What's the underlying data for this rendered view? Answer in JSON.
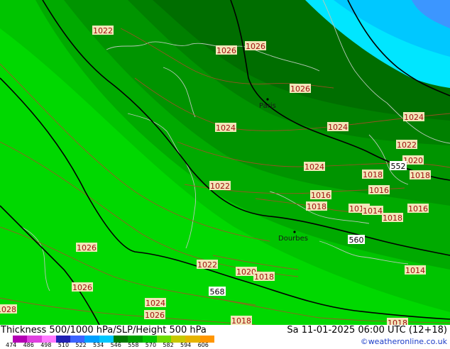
{
  "map": {
    "pressure_labels": [
      "1022",
      "1026",
      "1026",
      "1026",
      "1024",
      "1024",
      "1024",
      "1022",
      "1020",
      "1018",
      "1024",
      "1022",
      "1018",
      "1016",
      "1016",
      "1018",
      "1016",
      "1016",
      "1014",
      "1018",
      "1026",
      "1022",
      "1020",
      "1018",
      "1014",
      "1026",
      "1028",
      "1024",
      "1026",
      "1018",
      "1018"
    ],
    "height_labels": [
      "552",
      "560",
      "568"
    ],
    "cities": [
      "Paris",
      "Dourbes"
    ]
  },
  "footer": {
    "title": "Thickness 500/1000 hPa/SLP/Height 500 hPa",
    "datetime": "Sa 11-01-2025 06:00 UTC (12+18)",
    "credit": "©weatheronline.co.uk"
  },
  "legend": {
    "ticks": [
      "474",
      "486",
      "498",
      "510",
      "522",
      "534",
      "546",
      "558",
      "570",
      "582",
      "594",
      "606"
    ],
    "colors": [
      "#b400b4",
      "#e040e0",
      "#ff78ff",
      "#2020b4",
      "#3c64ff",
      "#00a0ff",
      "#00c8ff",
      "#007800",
      "#00a000",
      "#00c800",
      "#6cdc00",
      "#c8c800",
      "#e6b400",
      "#ff9600"
    ]
  },
  "colors": {
    "band_dark": "#006e00",
    "band_mid1": "#008200",
    "band_mid2": "#009600",
    "band_mid3": "#00b000",
    "band_light1": "#00c800",
    "band_light2": "#00dc00",
    "band_cyan": "#00c8ff",
    "band_lightcyan": "#00e6ff",
    "band_blue": "#3c96ff"
  }
}
